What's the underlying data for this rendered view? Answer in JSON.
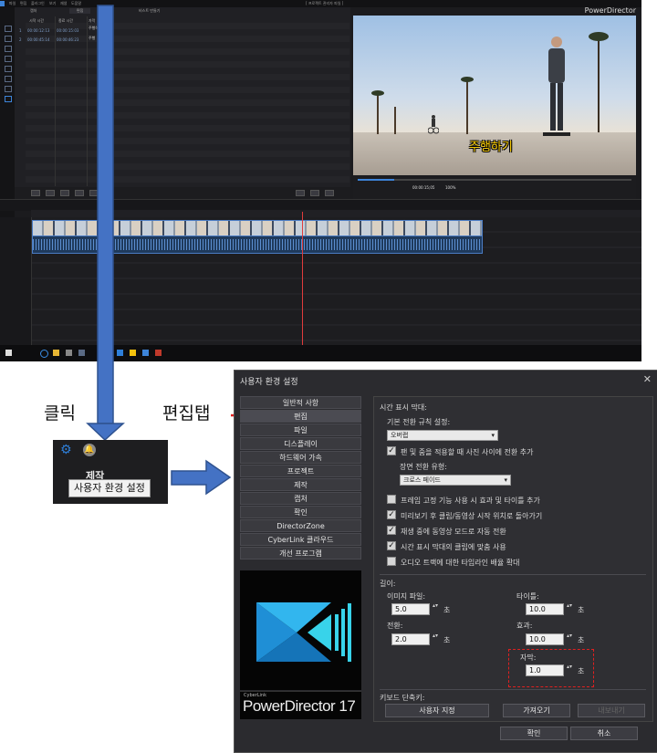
{
  "powerdirector": {
    "app_name": "PowerDirector",
    "menu": [
      "파일",
      "편집",
      "플러그인",
      "보기",
      "재생",
      "도움말"
    ],
    "window_title": "[ 프로젝트 관리자 파일 ]",
    "tabs": [
      "캡처",
      "편집",
      "미리 보기",
      "비스트 만들기"
    ],
    "columns": [
      "시작 시간",
      "종료 시간",
      "자막"
    ],
    "rows": [
      {
        "index": "1",
        "start": "00:00:12:13",
        "end": "00:00:15:03",
        "text": "주행하기"
      },
      {
        "index": "2",
        "start": "00:00:45:14",
        "end": "00:00:46:23",
        "text": "주행"
      }
    ],
    "preview_subtitle": "주행하기",
    "timecode": "00:00:15;05",
    "zoom": "100%"
  },
  "annotations": {
    "click_label": "클릭",
    "edit_tab_label": "편집탭"
  },
  "popup": {
    "production_label": "제작",
    "tooltip": "사용자 환경 설정"
  },
  "dialog": {
    "title": "사용자 환경 설정",
    "nav": [
      "일반적 사항",
      "편집",
      "파일",
      "디스플레이",
      "하드웨어 가속",
      "프로젝트",
      "제작",
      "캡처",
      "확인",
      "DirectorZone",
      "CyberLink 클라우드",
      "개선 프로그램"
    ],
    "selected_nav": "편집",
    "brand_small": "CyberLink",
    "brand_name": "PowerDirector 17",
    "timeline_section": "시간 표시 막대:",
    "default_transition_label": "기본 전환 규칙 설정:",
    "default_transition_value": "오버랩",
    "zoom_checkbox": "팬 및 줌을 적용할 때 사진 사이에 전환 추가",
    "scene_transition_label": "장면 전환 유형:",
    "scene_transition_value": "크로스 페이드",
    "options": [
      {
        "label": "프레임 고정 기능 사용 시 효과 및 타이틀 추가",
        "checked": false
      },
      {
        "label": "미리보기 후 클립/동영상 시작 위치로 돌아가기",
        "checked": true
      },
      {
        "label": "재생 중에 동영상 모드로 자동 전환",
        "checked": true
      },
      {
        "label": "시간 표시 막대의 클립에 맞춤 사용",
        "checked": true
      },
      {
        "label": "오디오 트랙에 대한 타임라인 배율 확대",
        "checked": false
      }
    ],
    "duration_section": "길이:",
    "image_file_label": "이미지 파일:",
    "image_file_value": "5.0",
    "title_label": "타이틀:",
    "title_value": "10.0",
    "transition_label": "전환:",
    "transition_value": "2.0",
    "effect_label": "효과:",
    "effect_value": "10.0",
    "subtitle_label": "자막:",
    "subtitle_value": "1.0",
    "unit": "초",
    "shortcut_section": "키보드 단축키:",
    "custom_button": "사용자 지정",
    "import_button": "가져오기",
    "export_button": "내보내기",
    "ok_button": "확인",
    "cancel_button": "취소"
  },
  "colors": {
    "accent_blue": "#4472c4",
    "highlight_red": "#e02020",
    "subtitle_yellow": "#ffd000"
  }
}
